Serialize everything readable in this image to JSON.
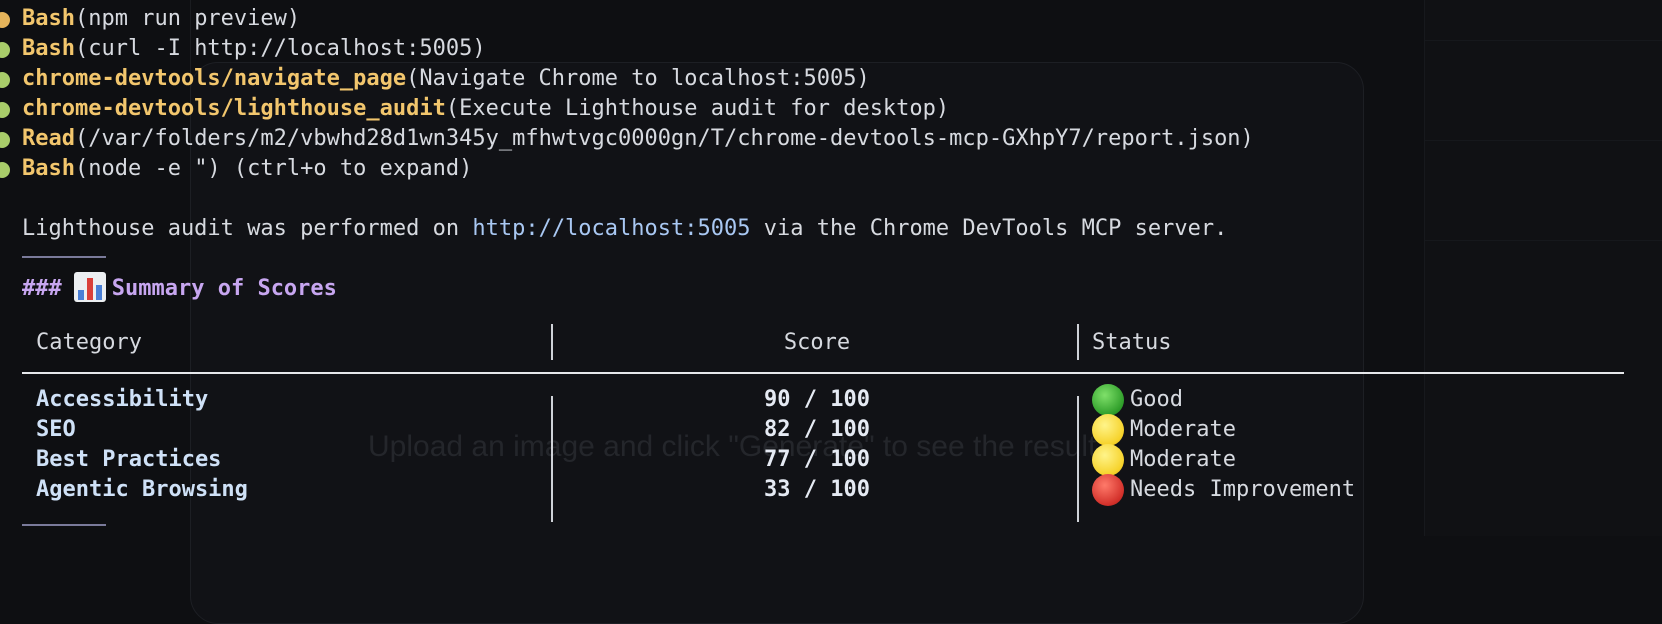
{
  "commands": [
    {
      "tool": "Bash",
      "arg": "(npm run preview)",
      "dot": "orange"
    },
    {
      "tool": "Bash",
      "arg": "(curl -I http://localhost:5005)",
      "dot": "green"
    },
    {
      "tool": "chrome-devtools/navigate_page",
      "arg": "(Navigate Chrome to localhost:5005)",
      "dot": "green"
    },
    {
      "tool": "chrome-devtools/lighthouse_audit",
      "arg": "(Execute Lighthouse audit for desktop)",
      "dot": "green"
    },
    {
      "tool": "Read",
      "arg": "(/var/folders/m2/vbwhd28d1wn345y_mfhwtvgc0000gn/T/chrome-devtools-mcp-GXhpY7/report.json)",
      "dot": "green"
    },
    {
      "tool": "Bash",
      "arg": "(node -e \") (ctrl+o to expand)",
      "dot": "green"
    }
  ],
  "message": {
    "prefix": "Lighthouse audit was performed on ",
    "link": "http://localhost:5005",
    "suffix": " via the Chrome DevTools MCP server."
  },
  "heading": {
    "hashes": "###",
    "icon": "bar-chart-icon",
    "title": "Summary of Scores"
  },
  "table": {
    "headers": [
      "Category",
      "Score",
      "Status"
    ],
    "rows": [
      {
        "category": "Accessibility",
        "score": "90 / 100",
        "status": "Good",
        "status_color": "green"
      },
      {
        "category": "SEO",
        "score": "82 / 100",
        "status": "Moderate",
        "status_color": "yellow"
      },
      {
        "category": "Best Practices",
        "score": "77 / 100",
        "status": "Moderate",
        "status_color": "yellow"
      },
      {
        "category": "Agentic Browsing",
        "score": "33 / 100",
        "status": "Needs Improvement",
        "status_color": "red"
      }
    ]
  },
  "background_hint": "Upload an image and click \"Generate\" to see the result",
  "colors": {
    "background": "#0e0f12",
    "tool_name": "#f2c66d",
    "link": "#a9c8f3",
    "heading": "#c7a6f0"
  }
}
